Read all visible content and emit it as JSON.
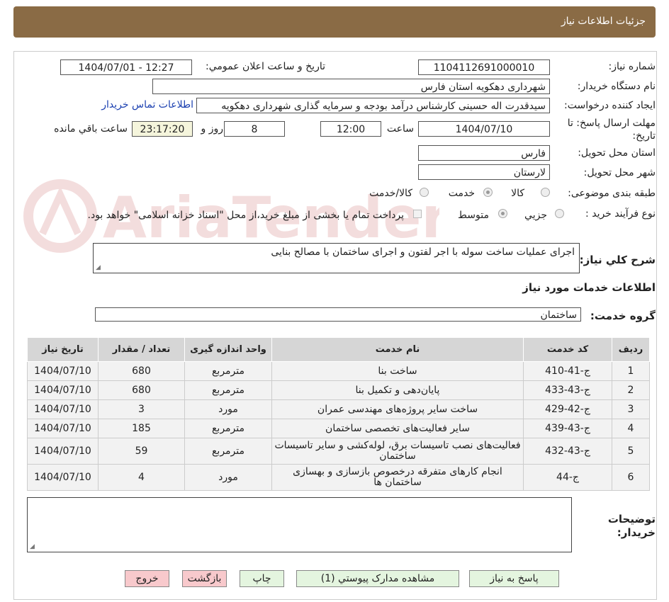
{
  "header": {
    "title": "جزئیات اطلاعات نیاز"
  },
  "form": {
    "need_number_label": "شماره نیاز:",
    "need_number": "1104112691000010",
    "announce_label": "تاریخ و ساعت اعلان عمومي:",
    "announce_value": "1404/07/01 - 12:27",
    "buyer_org_label": "نام دستگاه خريدار:",
    "buyer_org": "شهرداری دهکویه استان فارس",
    "requester_label": "ايجاد کننده درخواست:",
    "requester": "سیدقدرت اله حسینی کارشناس درآمد بودجه و سرمایه گذاری شهرداری دهکویه",
    "contact_link": "اطلاعات تماس خريدار",
    "deadline_label": "مهلت ارسال پاسخ: تا تاريخ:",
    "deadline_date": "1404/07/10",
    "time_label": "ساعت",
    "deadline_time": "12:00",
    "days_value": "8",
    "days_label": "روز و",
    "remaining_time": "23:17:20",
    "remaining_label": "ساعت باقي مانده",
    "province_label": "استان محل تحويل:",
    "province": "فارس",
    "city_label": "شهر محل تحويل:",
    "city": "لارستان",
    "category_label": "طبقه بندی موضوعی:",
    "category_options": [
      "کالا",
      "خدمت",
      "کالا/خدمت"
    ],
    "category_selected": "خدمت",
    "process_label": "نوع فرآيند خريد :",
    "process_options": [
      "جزيي",
      "متوسط"
    ],
    "process_selected": "متوسط",
    "payment_note": "پرداخت تمام يا بخشی از مبلغ خريد،از محل \"اسناد خزانه اسلامی\" خواهد بود.",
    "description_label": "شرح کلي نياز:",
    "description": "اجرای عملیات ساخت سوله با اجر لفتون و اجرای ساختمان با مصالح بنایی",
    "services_info_title": "اطلاعات خدمات مورد نياز",
    "service_group_label": "گروه خدمت:",
    "service_group": "ساختمان",
    "buyer_notes_label": "توضيحات خريدار:",
    "buyer_notes": ""
  },
  "watermark": {
    "text": "AriaTender.neT"
  },
  "table": {
    "headers": [
      "رديف",
      "کد خدمت",
      "نام خدمت",
      "واحد اندازه گيری",
      "تعداد / مقدار",
      "تاريخ نياز"
    ],
    "rows": [
      [
        "1",
        "ج-41-410",
        "ساخت بنا",
        "مترمربع",
        "680",
        "1404/07/10"
      ],
      [
        "2",
        "ج-43-433",
        "پایان‌دهی و تکمیل بنا",
        "مترمربع",
        "680",
        "1404/07/10"
      ],
      [
        "3",
        "ج-42-429",
        "ساخت سایر پروژه‌های مهندسی عمران",
        "مورد",
        "3",
        "1404/07/10"
      ],
      [
        "4",
        "ج-43-439",
        "سایر فعالیت‌های تخصصی ساختمان",
        "مترمربع",
        "185",
        "1404/07/10"
      ],
      [
        "5",
        "ج-43-432",
        "فعالیت‌های نصب تاسیسات برق، لوله‌کشی و سایر تاسیسات ساختمان",
        "مترمربع",
        "59",
        "1404/07/10"
      ],
      [
        "6",
        "ج-44",
        "انجام کارهای متفرقه درخصوص بازسازی و بهسازی ساختمان ها",
        "مورد",
        "4",
        "1404/07/10"
      ]
    ]
  },
  "buttons": {
    "reply": "پاسخ به نياز",
    "attachments": "مشاهده مدارک پيوستي (1)",
    "print": "چاپ",
    "back": "بازگشت",
    "exit": "خروج"
  }
}
